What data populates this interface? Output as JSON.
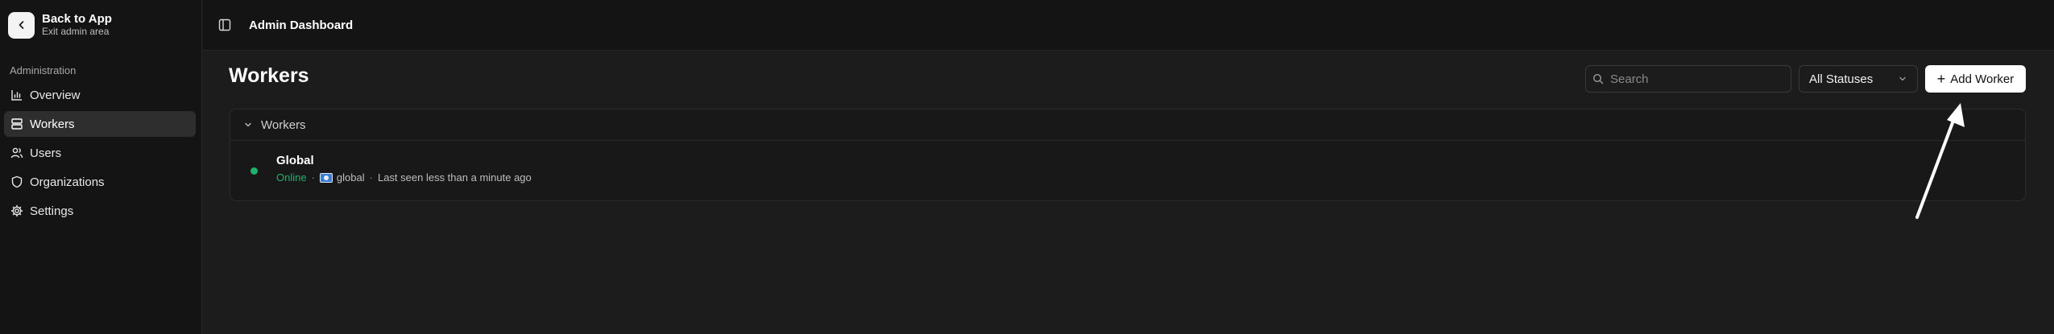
{
  "sidebar": {
    "back_title": "Back to App",
    "back_subtitle": "Exit admin area",
    "section_label": "Administration",
    "items": [
      {
        "label": "Overview",
        "icon": "bar-chart-icon",
        "active": false
      },
      {
        "label": "Workers",
        "icon": "server-icon",
        "active": true
      },
      {
        "label": "Users",
        "icon": "users-icon",
        "active": false
      },
      {
        "label": "Organizations",
        "icon": "shield-icon",
        "active": false
      },
      {
        "label": "Settings",
        "icon": "gear-icon",
        "active": false
      }
    ]
  },
  "topbar": {
    "title": "Admin Dashboard",
    "toggle_icon": "sidebar-toggle-icon"
  },
  "main": {
    "title": "Workers",
    "search": {
      "placeholder": "Search",
      "value": ""
    },
    "status_filter": {
      "selected": "All Statuses"
    },
    "add_button": {
      "label": "Add Worker"
    },
    "group": {
      "label": "Workers",
      "expanded": true,
      "workers": [
        {
          "name": "Global",
          "status": "Online",
          "region": "global",
          "last_seen": "Last seen less than a minute ago"
        }
      ]
    }
  },
  "colors": {
    "online": "#1fb26b",
    "background": "#1c1c1c",
    "sidebar": "#141414"
  }
}
